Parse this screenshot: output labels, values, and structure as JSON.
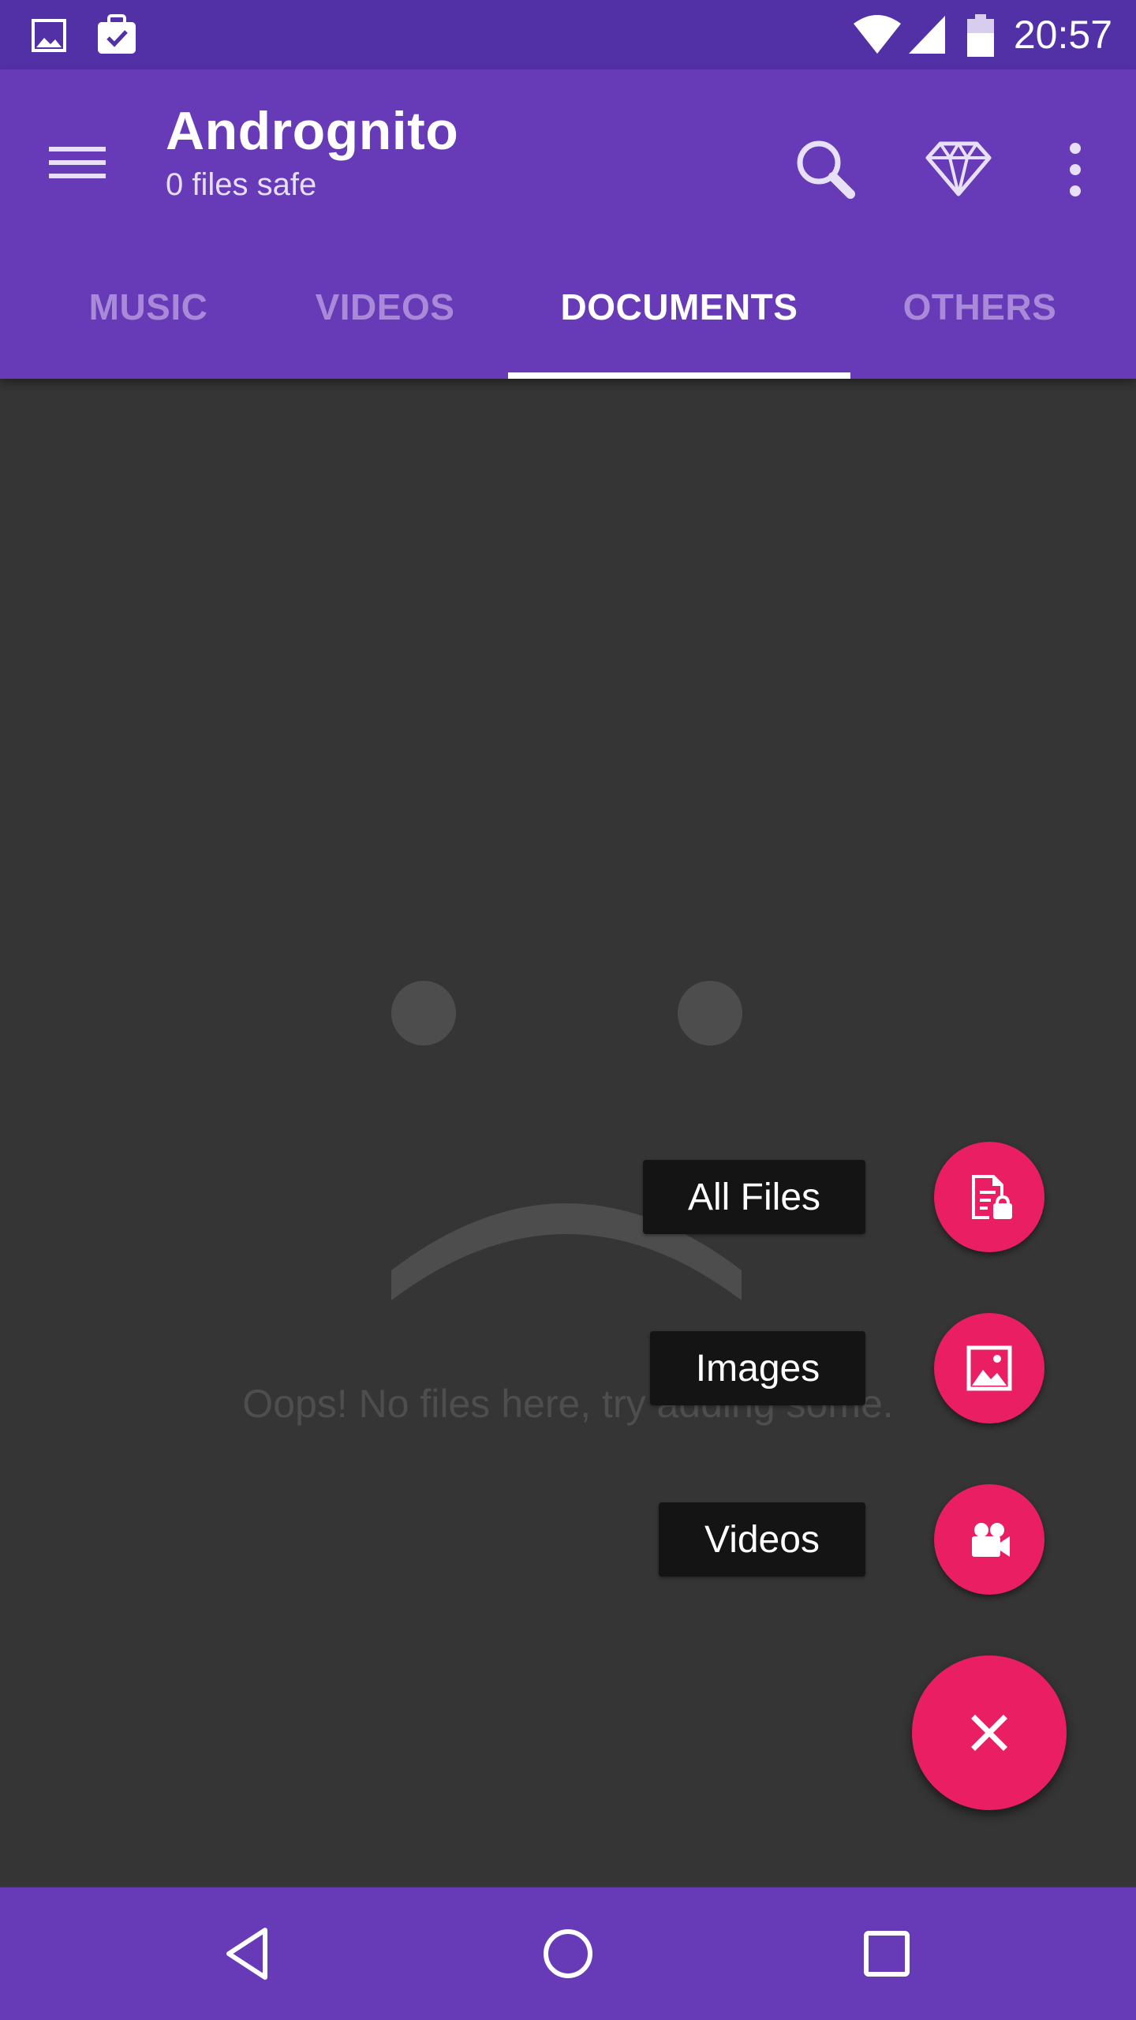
{
  "status_bar": {
    "time": "20:57",
    "icons": [
      "image-notification-icon",
      "briefcase-check-icon",
      "wifi-icon",
      "cell-signal-icon",
      "battery-icon"
    ]
  },
  "app_bar": {
    "title": "Andrognito",
    "subtitle": "0 files safe",
    "actions": [
      "search-icon",
      "diamond-icon",
      "more-vert-icon"
    ]
  },
  "tabs": [
    {
      "label": "MUSIC",
      "active": false
    },
    {
      "label": "VIDEOS",
      "active": false
    },
    {
      "label": "DOCUMENTS",
      "active": true
    },
    {
      "label": "OTHERS",
      "active": false
    }
  ],
  "empty_state": {
    "message": "Oops! No files here, try adding some.",
    "icon": "sad-face-icon"
  },
  "fab_menu": {
    "items": [
      {
        "label": "All Files",
        "icon": "file-lock-icon"
      },
      {
        "label": "Images",
        "icon": "image-icon"
      },
      {
        "label": "Videos",
        "icon": "video-camera-icon"
      }
    ],
    "close_icon": "close-icon"
  },
  "nav_bar": {
    "buttons": [
      "back-icon",
      "home-icon",
      "recents-icon"
    ]
  },
  "colors": {
    "primary": "#673ab7",
    "primary_dark": "#5230a6",
    "accent": "#e91e63",
    "background": "#3a3a3a"
  }
}
